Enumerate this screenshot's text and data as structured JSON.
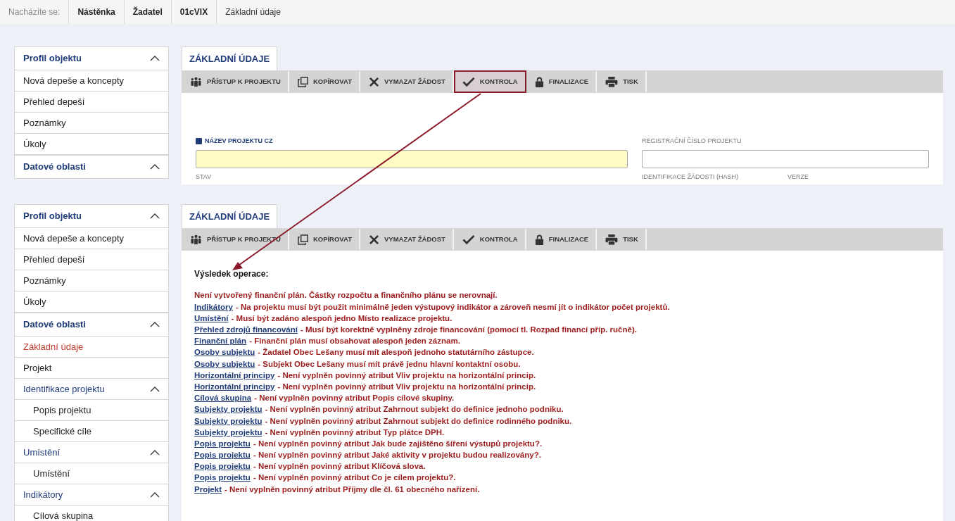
{
  "breadcrumb": {
    "label": "Nacházíte se:",
    "items": [
      "Nástěnka",
      "Žadatel",
      "01cVIX",
      "Základní údaje"
    ]
  },
  "panels": [
    {
      "sidebar": [
        {
          "label": "Profil objektu",
          "expanded": true,
          "items": [
            {
              "label": "Nová depeše a koncepty",
              "selected": false
            },
            {
              "label": "Přehled depeší",
              "selected": false
            },
            {
              "label": "Poznámky",
              "selected": false
            },
            {
              "label": "Úkoly",
              "selected": false
            }
          ]
        },
        {
          "label": "Datové oblasti",
          "expanded": true
        }
      ],
      "tab": "ZÁKLADNÍ ÚDAJE",
      "toolbar": [
        {
          "kind": "people",
          "label": "PŘÍSTUP K PROJEKTU",
          "highlighted": false
        },
        {
          "kind": "copy",
          "label": "KOPÍROVAT",
          "highlighted": false
        },
        {
          "kind": "cross",
          "label": "VYMAZAT ŽÁDOST",
          "highlighted": false
        },
        {
          "kind": "check",
          "label": "KONTROLA",
          "highlighted": true
        },
        {
          "kind": "lock",
          "label": "FINALIZACE",
          "highlighted": false
        },
        {
          "kind": "print",
          "label": "TISK",
          "highlighted": false
        }
      ],
      "form": {
        "name_label": "NÁZEV PROJEKTU CZ",
        "reg_label": "REGISTRAČNÍ ČÍSLO PROJEKTU",
        "state_label": "STAV",
        "hash_label": "IDENTIFIKACE ŽÁDOSTI (HASH)",
        "version_label": "VERZE"
      }
    },
    {
      "sidebar": [
        {
          "label": "Profil objektu",
          "expanded": true,
          "items": [
            {
              "label": "Nová depeše a koncepty",
              "selected": false
            },
            {
              "label": "Přehled depeší",
              "selected": false
            },
            {
              "label": "Poznámky",
              "selected": false
            },
            {
              "label": "Úkoly",
              "selected": false
            }
          ]
        },
        {
          "label": "Datové oblasti",
          "expanded": true,
          "items": [
            {
              "label": "Základní údaje",
              "selected": true
            },
            {
              "label": "Projekt",
              "selected": false
            },
            {
              "label": "Identifikace projektu",
              "selected": false,
              "expanded": true,
              "children": [
                {
                  "label": "Popis projektu",
                  "selected": false
                },
                {
                  "label": "Specifické cíle",
                  "selected": false
                }
              ]
            },
            {
              "label": "Umístění",
              "selected": false,
              "expanded": true,
              "children": [
                {
                  "label": "Umístění",
                  "selected": false
                }
              ]
            },
            {
              "label": "Indikátory",
              "selected": false,
              "expanded": true,
              "children": [
                {
                  "label": "Cílová skupina",
                  "selected": false
                }
              ]
            }
          ]
        }
      ],
      "tab": "ZÁKLADNÍ ÚDAJE",
      "toolbar": [
        {
          "kind": "people",
          "label": "PŘÍSTUP K PROJEKTU",
          "highlighted": false
        },
        {
          "kind": "copy",
          "label": "KOPÍROVAT",
          "highlighted": false
        },
        {
          "kind": "cross",
          "label": "VYMAZAT ŽÁDOST",
          "highlighted": false
        },
        {
          "kind": "check",
          "label": "KONTROLA",
          "highlighted": false
        },
        {
          "kind": "lock",
          "label": "FINALIZACE",
          "highlighted": false
        },
        {
          "kind": "print",
          "label": "TISK",
          "highlighted": false
        }
      ],
      "result": {
        "title": "Výsledek operace:",
        "messages": [
          {
            "text": "Není vytvořený finanční plán. Částky rozpočtu a finančního plánu se nerovnají."
          },
          {
            "link": "Indikátory",
            "text": "- Na projektu musí být použit minimálně jeden výstupový indikátor a zároveň nesmí jít o indikátor počet projektů."
          },
          {
            "link": "Umístění",
            "text": "- Musí být zadáno alespoň jedno Místo realizace projektu."
          },
          {
            "link": "Přehled zdrojů financování",
            "text": "- Musí být korektně vyplněny zdroje financování (pomocí tl. Rozpad financí příp. ručně)."
          },
          {
            "link": "Finanční plán",
            "text": "- Finanční plán musí obsahovat alespoň jeden záznam."
          },
          {
            "link": "Osoby subjektu",
            "text": "- Žadatel Obec Lešany musí mít alespoň jednoho statutárního zástupce."
          },
          {
            "link": "Osoby subjektu",
            "text": "- Subjekt Obec Lešany musí mít právě jednu hlavní kontaktní osobu."
          },
          {
            "link": "Horizontální principy",
            "text": "- Není vyplněn povinný atribut Vliv projektu na horizontální princip."
          },
          {
            "link": "Horizontální principy",
            "text": "- Není vyplněn povinný atribut Vliv projektu na horizontální princip."
          },
          {
            "link": "Cílová skupina",
            "text": "- Není vyplněn povinný atribut Popis cílové skupiny."
          },
          {
            "link": "Subjekty projektu",
            "text": "- Není vyplněn povinný atribut Zahrnout subjekt do definice jednoho podniku."
          },
          {
            "link": "Subjekty projektu",
            "text": "- Není vyplněn povinný atribut Zahrnout subjekt do definice rodinného podniku."
          },
          {
            "link": "Subjekty projektu",
            "text": "- Není vyplněn povinný atribut Typ plátce DPH."
          },
          {
            "link": "Popis projektu",
            "text": "- Není vyplněn povinný atribut Jak bude zajištěno šíření výstupů projektu?."
          },
          {
            "link": "Popis projektu",
            "text": "- Není vyplněn povinný atribut Jaké aktivity v projektu budou realizovány?."
          },
          {
            "link": "Popis projektu",
            "text": "- Není vyplněn povinný atribut Klíčová slova."
          },
          {
            "link": "Popis projektu",
            "text": "- Není vyplněn povinný atribut Co je cílem projektu?."
          },
          {
            "link": "Projekt",
            "text": "- Není vyplněn povinný atribut Příjmy dle čl. 61 obecného nařízení."
          }
        ]
      }
    }
  ]
}
